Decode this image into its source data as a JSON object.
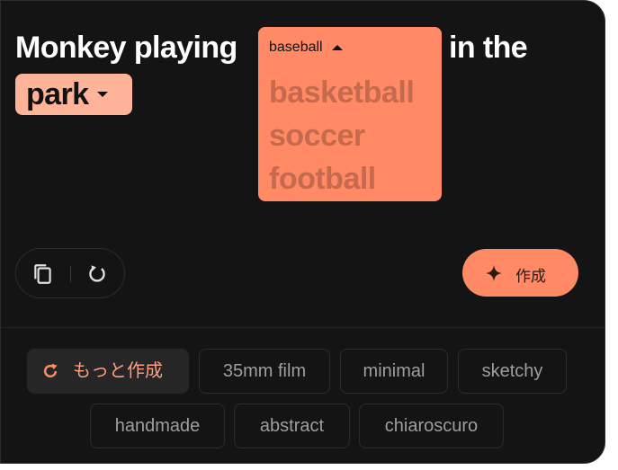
{
  "prompt": {
    "part1": "Monkey playing",
    "part2": "in the",
    "chip1": {
      "selected": "baseball",
      "icon": "caret-up-icon"
    },
    "chip2": {
      "selected": "park",
      "icon": "caret-down-icon"
    },
    "dropdown_options": [
      "basketball",
      "soccer",
      "football"
    ]
  },
  "actions": {
    "copy_icon": "copy-icon",
    "reset_icon": "reset-icon",
    "create_label": "作成",
    "create_icon": "sparkle-icon"
  },
  "suggestions": {
    "more_label": "もっと作成",
    "more_icon": "refresh-icon",
    "styles": [
      "35mm film",
      "minimal",
      "sketchy",
      "handmade",
      "abstract",
      "chiaroscuro"
    ]
  },
  "colors": {
    "accent": "#ff8a65",
    "chip_light": "#ffb399",
    "background": "#141414"
  }
}
